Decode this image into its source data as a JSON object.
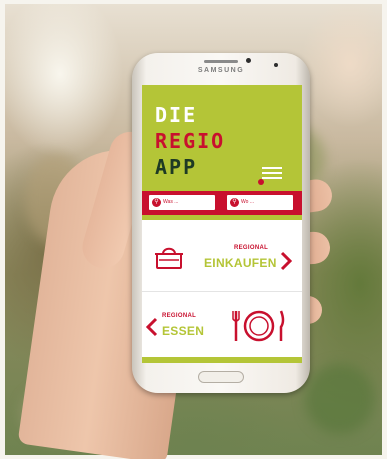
{
  "phone": {
    "brand": "SAMSUNG"
  },
  "app": {
    "logo_lines": [
      "DIE",
      "REGIO",
      "APP"
    ],
    "logo_colors": [
      "#ffffff",
      "#c8102e",
      "#ffffff"
    ],
    "accent_green": "#b4c537",
    "accent_red": "#c8102e",
    "menu_icon": "hamburger-menu-icon",
    "search": {
      "what_placeholder": "Was ...",
      "where_placeholder": "Wo ..."
    },
    "sections": {
      "shopping": {
        "small": "REGIONAL",
        "big": "EINKAUFEN",
        "icon": "basket-icon",
        "arrow": "chevron-right-icon"
      },
      "food": {
        "small": "REGIONAL",
        "big": "ESSEN",
        "icon": "plate-cutlery-icon",
        "arrow": "chevron-left-icon"
      }
    }
  }
}
